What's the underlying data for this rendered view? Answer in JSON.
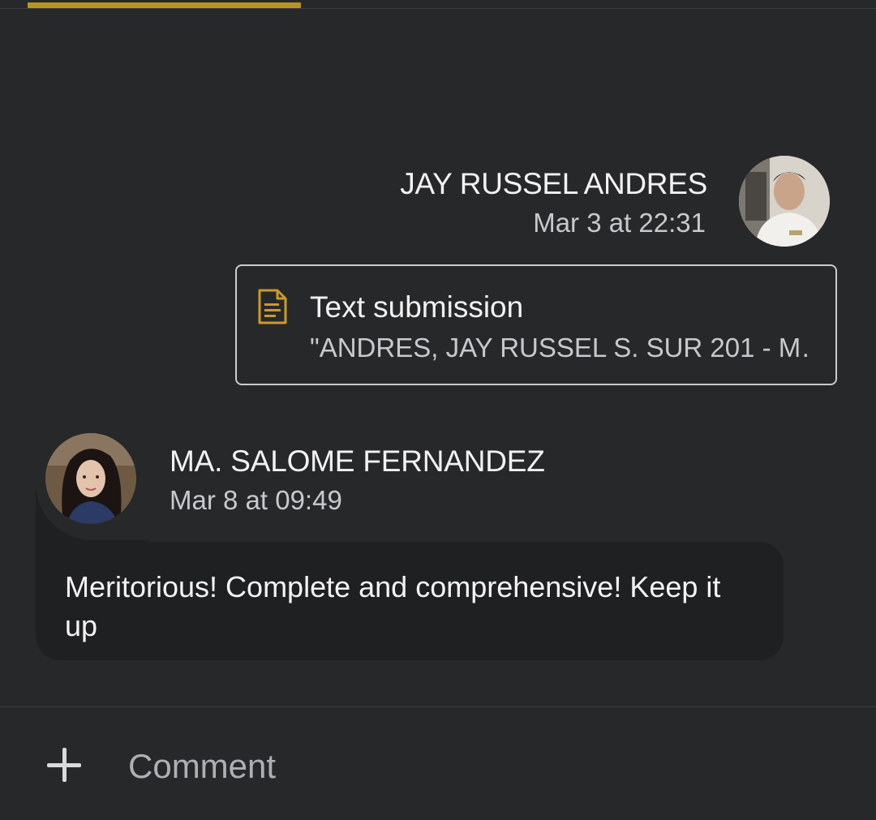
{
  "tabs": {
    "active_indicator_color": "#b89424"
  },
  "messages": [
    {
      "author": "JAY RUSSEL ANDRES",
      "time": "Mar 3 at 22:31",
      "attachment": {
        "icon": "document-icon",
        "title": "Text submission",
        "preview": "\"ANDRES, JAY RUSSEL S. SUR 201 - M…"
      }
    },
    {
      "author": "MA. SALOME FERNANDEZ",
      "time": "Mar 8 at 09:49",
      "body": "Meritorious! Complete and comprehensive! Keep it up"
    }
  ],
  "composer": {
    "add_icon": "plus-icon",
    "placeholder": "Comment"
  }
}
